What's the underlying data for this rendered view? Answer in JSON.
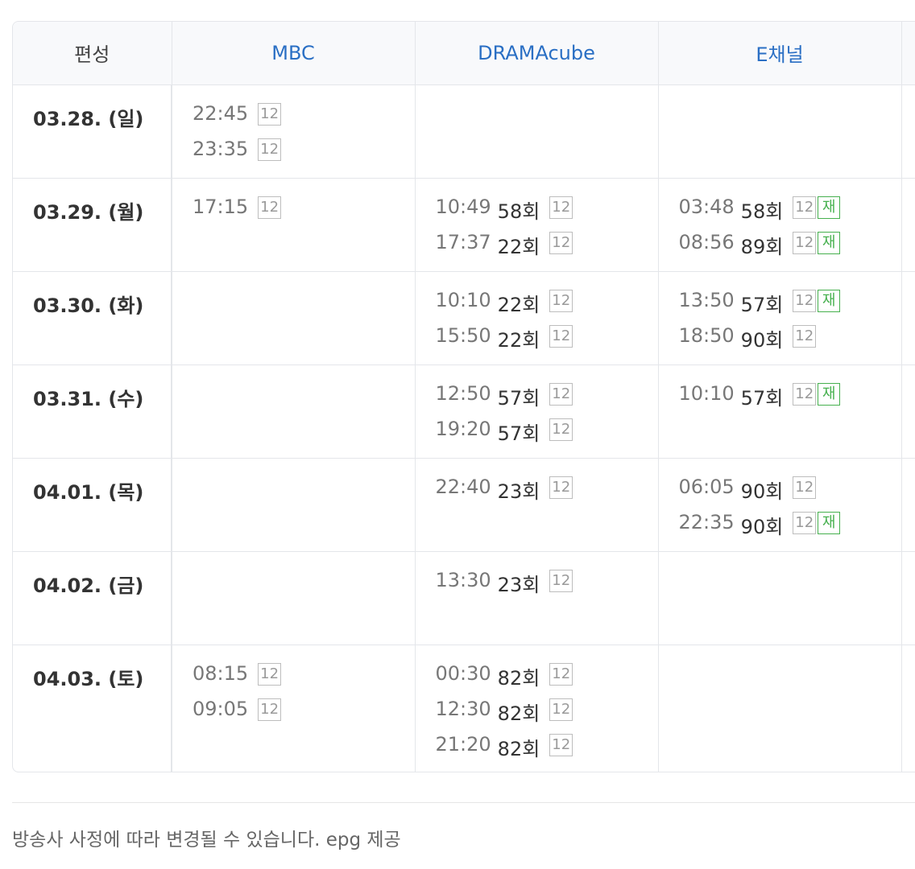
{
  "header": {
    "corner_label": "편성",
    "channels": [
      "MBC",
      "DRAMAcube",
      "E채널",
      ""
    ]
  },
  "rows": [
    {
      "date": "03.28. (일)",
      "cells": [
        [
          {
            "time": "22:45",
            "ep": "",
            "age": "12",
            "re": ""
          },
          {
            "time": "23:35",
            "ep": "",
            "age": "12",
            "re": ""
          }
        ],
        [],
        [],
        []
      ]
    },
    {
      "date": "03.29. (월)",
      "cells": [
        [
          {
            "time": "17:15",
            "ep": "",
            "age": "12",
            "re": ""
          }
        ],
        [
          {
            "time": "10:49",
            "ep": "58회",
            "age": "12",
            "re": ""
          },
          {
            "time": "17:37",
            "ep": "22회",
            "age": "12",
            "re": ""
          }
        ],
        [
          {
            "time": "03:48",
            "ep": "58회",
            "age": "12",
            "re": "재"
          },
          {
            "time": "08:56",
            "ep": "89회",
            "age": "12",
            "re": "재"
          }
        ],
        []
      ]
    },
    {
      "date": "03.30. (화)",
      "cells": [
        [],
        [
          {
            "time": "10:10",
            "ep": "22회",
            "age": "12",
            "re": ""
          },
          {
            "time": "15:50",
            "ep": "22회",
            "age": "12",
            "re": ""
          }
        ],
        [
          {
            "time": "13:50",
            "ep": "57회",
            "age": "12",
            "re": "재"
          },
          {
            "time": "18:50",
            "ep": "90회",
            "age": "12",
            "re": ""
          }
        ],
        []
      ]
    },
    {
      "date": "03.31. (수)",
      "cells": [
        [],
        [
          {
            "time": "12:50",
            "ep": "57회",
            "age": "12",
            "re": ""
          },
          {
            "time": "19:20",
            "ep": "57회",
            "age": "12",
            "re": ""
          }
        ],
        [
          {
            "time": "10:10",
            "ep": "57회",
            "age": "12",
            "re": "재"
          }
        ],
        []
      ]
    },
    {
      "date": "04.01. (목)",
      "cells": [
        [],
        [
          {
            "time": "22:40",
            "ep": "23회",
            "age": "12",
            "re": ""
          }
        ],
        [
          {
            "time": "06:05",
            "ep": "90회",
            "age": "12",
            "re": ""
          },
          {
            "time": "22:35",
            "ep": "90회",
            "age": "12",
            "re": "재"
          }
        ],
        []
      ]
    },
    {
      "date": "04.02. (금)",
      "cells": [
        [],
        [
          {
            "time": "13:30",
            "ep": "23회",
            "age": "12",
            "re": ""
          }
        ],
        [],
        []
      ]
    },
    {
      "date": "04.03. (토)",
      "cells": [
        [
          {
            "time": "08:15",
            "ep": "",
            "age": "12",
            "re": ""
          },
          {
            "time": "09:05",
            "ep": "",
            "age": "12",
            "re": ""
          }
        ],
        [
          {
            "time": "00:30",
            "ep": "82회",
            "age": "12",
            "re": ""
          },
          {
            "time": "12:30",
            "ep": "82회",
            "age": "12",
            "re": ""
          },
          {
            "time": "21:20",
            "ep": "82회",
            "age": "12",
            "re": ""
          }
        ],
        [],
        []
      ]
    }
  ],
  "footer": {
    "note": "방송사 사정에 따라 변경될 수 있습니다. epg 제공"
  }
}
